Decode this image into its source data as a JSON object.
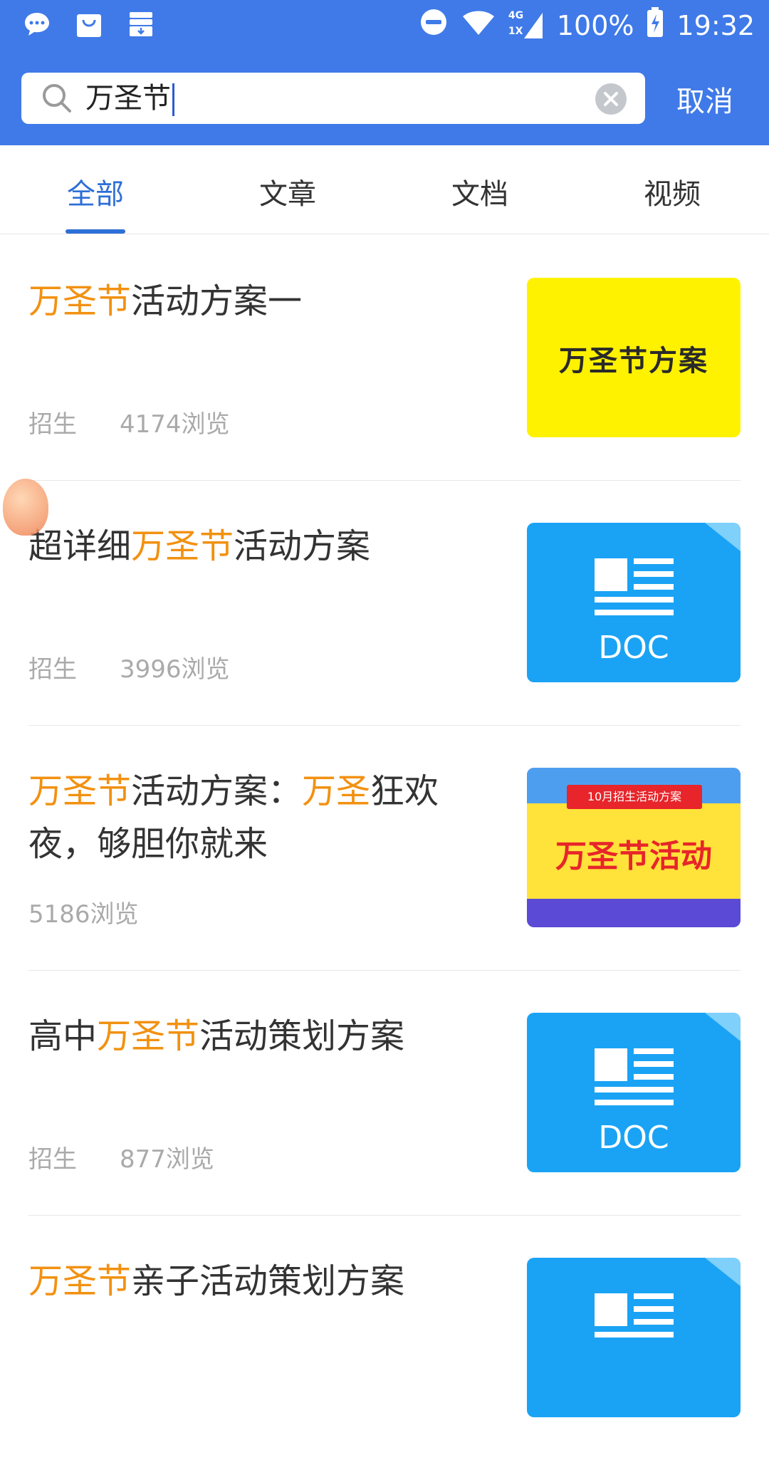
{
  "status": {
    "network": "4G",
    "sim": "1X",
    "battery": "100%",
    "time": "19:32"
  },
  "search": {
    "query": "万圣节",
    "cancel_label": "取消"
  },
  "tabs": [
    {
      "label": "全部",
      "active": true
    },
    {
      "label": "文章",
      "active": false
    },
    {
      "label": "文档",
      "active": false
    },
    {
      "label": "视频",
      "active": false
    }
  ],
  "results": [
    {
      "title_hl1": "万圣节",
      "title_rest1": "活动方案一",
      "category": "招生",
      "views": "4174浏览",
      "thumb_text": "万圣节方案"
    },
    {
      "title_pre": "超详细",
      "title_hl1": "万圣节",
      "title_rest1": "活动方案",
      "category": "招生",
      "views": "3996浏览",
      "thumb_text": "DOC"
    },
    {
      "title_hl1": "万圣节",
      "title_rest1": "活动方案：",
      "title_hl2": "万圣",
      "title_rest2": "狂欢夜，够胆你就来",
      "views": "5186浏览",
      "thumb_ribbon": "10月招生活动方案",
      "thumb_text": "万圣节活动"
    },
    {
      "title_pre": "高中",
      "title_hl1": "万圣节",
      "title_rest1": "活动策划方案",
      "category": "招生",
      "views": "877浏览",
      "thumb_text": "DOC"
    },
    {
      "title_hl1": "万圣节",
      "title_rest1": "亲子活动策划方案"
    }
  ],
  "colors": {
    "header_blue": "#3f7ae8",
    "tab_active": "#2d6fd6",
    "highlight_orange": "#f29111",
    "doc_blue": "#1aa3f5"
  }
}
